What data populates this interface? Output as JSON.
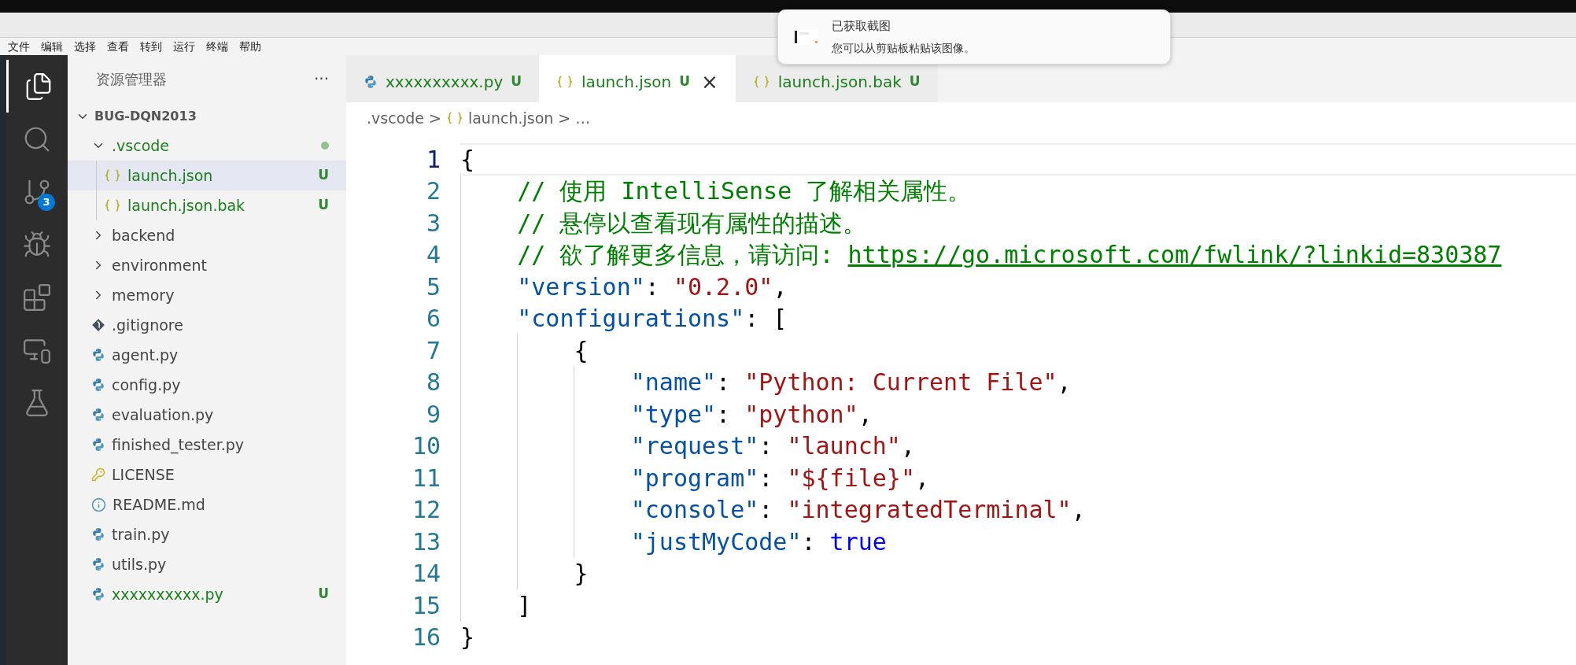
{
  "menu": [
    "文件",
    "编辑",
    "选择",
    "查看",
    "转到",
    "运行",
    "终端",
    "帮助"
  ],
  "activity_bar": [
    {
      "kind": "explorer",
      "selected": true
    },
    {
      "kind": "search",
      "selected": false
    },
    {
      "kind": "source-control",
      "selected": false,
      "badge": "3"
    },
    {
      "kind": "run-debug",
      "selected": false
    },
    {
      "kind": "extensions",
      "selected": false
    },
    {
      "kind": "remote",
      "selected": false
    },
    {
      "kind": "testing",
      "selected": false
    }
  ],
  "sidebar": {
    "title": "资源管理器",
    "more": "···",
    "root": {
      "label": "BUG-DQN2013",
      "expanded": true,
      "children": [
        {
          "label": ".vscode",
          "kind": "folder",
          "expanded": true,
          "untracked": true,
          "dot": true,
          "selected": false,
          "children": [
            {
              "label": "launch.json",
              "kind": "json",
              "untracked": true,
              "badge": "U",
              "selected": true
            },
            {
              "label": "launch.json.bak",
              "kind": "json",
              "untracked": true,
              "badge": "U",
              "selected": false
            }
          ]
        },
        {
          "label": "backend",
          "kind": "folder",
          "expanded": false,
          "untracked": false,
          "selected": false
        },
        {
          "label": "environment",
          "kind": "folder",
          "expanded": false,
          "untracked": false,
          "selected": false
        },
        {
          "label": "memory",
          "kind": "folder",
          "expanded": false,
          "untracked": false,
          "selected": false
        },
        {
          "label": ".gitignore",
          "kind": "git",
          "untracked": false,
          "selected": false
        },
        {
          "label": "agent.py",
          "kind": "python",
          "untracked": false,
          "selected": false
        },
        {
          "label": "config.py",
          "kind": "python",
          "untracked": false,
          "selected": false
        },
        {
          "label": "evaluation.py",
          "kind": "python",
          "untracked": false,
          "selected": false
        },
        {
          "label": "finished_tester.py",
          "kind": "python",
          "untracked": false,
          "selected": false
        },
        {
          "label": "LICENSE",
          "kind": "license",
          "untracked": false,
          "selected": false
        },
        {
          "label": "README.md",
          "kind": "info",
          "untracked": false,
          "selected": false
        },
        {
          "label": "train.py",
          "kind": "python",
          "untracked": false,
          "selected": false
        },
        {
          "label": "utils.py",
          "kind": "python",
          "untracked": false,
          "selected": false
        },
        {
          "label": "xxxxxxxxxx.py",
          "kind": "python",
          "untracked": true,
          "badge": "U",
          "selected": false
        }
      ]
    }
  },
  "tabs": [
    {
      "label": "xxxxxxxxxx.py",
      "kind": "python",
      "badge": "U",
      "selected": false
    },
    {
      "label": "launch.json",
      "kind": "json",
      "badge": "U",
      "selected": true,
      "close": "×"
    },
    {
      "label": "launch.json.bak",
      "kind": "json",
      "badge": "U",
      "selected": false
    }
  ],
  "breadcrumb": [
    {
      "kind": "text",
      "text": ".vscode"
    },
    {
      "kind": "sep",
      "text": ">"
    },
    {
      "kind": "json",
      "text": "launch.json"
    },
    {
      "kind": "sep",
      "text": ">"
    },
    {
      "kind": "text",
      "text": "…"
    }
  ],
  "code": [
    {
      "number": "1",
      "current": true,
      "tokens": [
        {
          "kind": "punct",
          "text": "{"
        }
      ]
    },
    {
      "number": "2",
      "current": false,
      "tokens": [
        {
          "kind": "comment",
          "text": "    // 使用 IntelliSense 了解相关属性。"
        }
      ]
    },
    {
      "number": "3",
      "current": false,
      "tokens": [
        {
          "kind": "comment",
          "text": "    // 悬停以查看现有属性的描述。"
        }
      ]
    },
    {
      "number": "4",
      "current": false,
      "tokens": [
        {
          "kind": "comment",
          "text": "    // 欲了解更多信息，请访问: "
        },
        {
          "kind": "link",
          "text": "https://go.microsoft.com/fwlink/?linkid=830387"
        }
      ]
    },
    {
      "number": "5",
      "current": false,
      "tokens": [
        {
          "kind": "key",
          "text": "    \"version\""
        },
        {
          "kind": "punct",
          "text": ": "
        },
        {
          "kind": "string",
          "text": "\"0.2.0\""
        },
        {
          "kind": "punct",
          "text": ","
        }
      ]
    },
    {
      "number": "6",
      "current": false,
      "tokens": [
        {
          "kind": "key",
          "text": "    \"configurations\""
        },
        {
          "kind": "punct",
          "text": ": ["
        }
      ]
    },
    {
      "number": "7",
      "current": false,
      "tokens": [
        {
          "kind": "punct",
          "text": "        {"
        }
      ]
    },
    {
      "number": "8",
      "current": false,
      "tokens": [
        {
          "kind": "key",
          "text": "            \"name\""
        },
        {
          "kind": "punct",
          "text": ": "
        },
        {
          "kind": "string",
          "text": "\"Python: Current File\""
        },
        {
          "kind": "punct",
          "text": ","
        }
      ]
    },
    {
      "number": "9",
      "current": false,
      "tokens": [
        {
          "kind": "key",
          "text": "            \"type\""
        },
        {
          "kind": "punct",
          "text": ": "
        },
        {
          "kind": "string",
          "text": "\"python\""
        },
        {
          "kind": "punct",
          "text": ","
        }
      ]
    },
    {
      "number": "10",
      "current": false,
      "tokens": [
        {
          "kind": "key",
          "text": "            \"request\""
        },
        {
          "kind": "punct",
          "text": ": "
        },
        {
          "kind": "string",
          "text": "\"launch\""
        },
        {
          "kind": "punct",
          "text": ","
        }
      ]
    },
    {
      "number": "11",
      "current": false,
      "tokens": [
        {
          "kind": "key",
          "text": "            \"program\""
        },
        {
          "kind": "punct",
          "text": ": "
        },
        {
          "kind": "string",
          "text": "\"${file}\""
        },
        {
          "kind": "punct",
          "text": ","
        }
      ]
    },
    {
      "number": "12",
      "current": false,
      "tokens": [
        {
          "kind": "key",
          "text": "            \"console\""
        },
        {
          "kind": "punct",
          "text": ": "
        },
        {
          "kind": "string",
          "text": "\"integratedTerminal\""
        },
        {
          "kind": "punct",
          "text": ","
        }
      ]
    },
    {
      "number": "13",
      "current": false,
      "tokens": [
        {
          "kind": "key",
          "text": "            \"justMyCode\""
        },
        {
          "kind": "punct",
          "text": ": "
        },
        {
          "kind": "keyword",
          "text": "true"
        }
      ]
    },
    {
      "number": "14",
      "current": false,
      "tokens": [
        {
          "kind": "punct",
          "text": "        }"
        }
      ]
    },
    {
      "number": "15",
      "current": false,
      "tokens": [
        {
          "kind": "punct",
          "text": "    ]"
        }
      ]
    },
    {
      "number": "16",
      "current": false,
      "tokens": [
        {
          "kind": "punct",
          "text": "}"
        }
      ]
    }
  ],
  "notification": {
    "title": "已获取截图",
    "body": "您可以从剪贴板粘贴该图像。"
  }
}
